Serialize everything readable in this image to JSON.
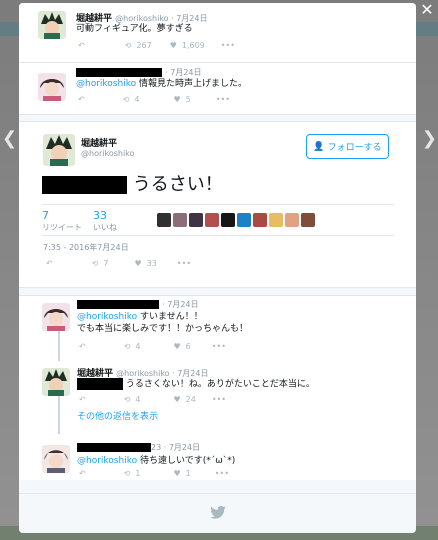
{
  "tweets": [
    {
      "name": "堀越耕平",
      "handle": "@horikoshiko",
      "date": "7月24日",
      "text": "可動フィギュア化。夢すぎる",
      "retweets": "267",
      "likes": "1,609"
    },
    {
      "name": "",
      "handle": "",
      "date": "7月24日",
      "mention": "@horikoshiko",
      "text": "情報見た時声上げました。",
      "retweets": "4",
      "likes": "5"
    }
  ],
  "main_tweet": {
    "name": "堀越耕平",
    "handle": "@horikoshiko",
    "follow_label": "フォローする",
    "text": "うるさい！",
    "retweet_count": "7",
    "retweet_label": "リツイート",
    "like_count": "33",
    "like_label": "いいね",
    "timestamp": "7:35 - 2016年7月24日",
    "footer_retweets": "7",
    "footer_likes": "33"
  },
  "replies": [
    {
      "date": "7月24日",
      "mention": "@horikoshiko",
      "line1": "すいません！！",
      "line2": "でも本当に楽しみです！！かっちゃんも！",
      "retweets": "4",
      "likes": "6"
    },
    {
      "name": "堀越耕平",
      "handle": "@horikoshiko",
      "date": "7月24日",
      "text": "うるさくない！ね。ありがたいことだ本当に。",
      "retweets": "4",
      "likes": "24",
      "more_label": "その他の返信を表示"
    },
    {
      "handle_suffix": "23",
      "date": "7月24日",
      "mention": "@horikoshiko",
      "text": "待ち遠しいです(*´ω`*)",
      "retweets": "1",
      "likes": "1"
    }
  ],
  "colors": {
    "accent": "#1da1f2",
    "muted": "#8899a6",
    "border": "#e1e8ed"
  },
  "icons": [
    "close-icon",
    "reply-icon",
    "retweet-icon",
    "heart-icon",
    "more-icon",
    "follow-person-icon",
    "twitter-bird-icon",
    "chevron-left-icon",
    "chevron-right-icon"
  ]
}
